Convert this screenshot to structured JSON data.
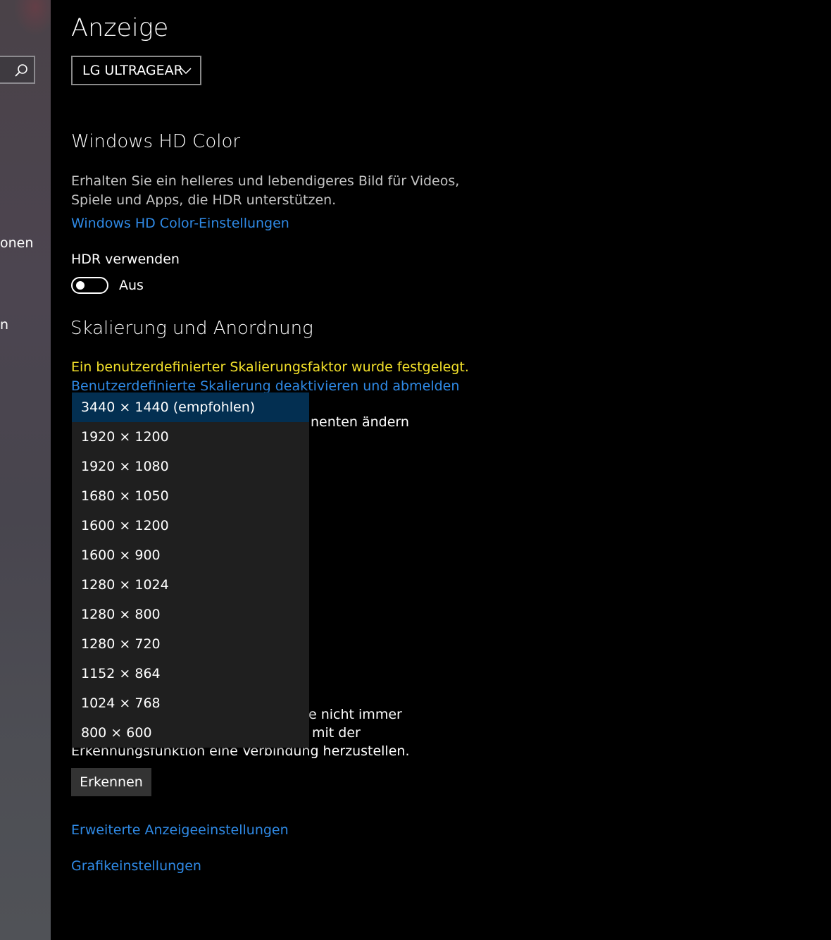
{
  "sidebar": {
    "partial_labels": [
      "onen",
      "n"
    ]
  },
  "page": {
    "title": "Anzeige",
    "display_select": {
      "value": "LG ULTRAGEAR"
    }
  },
  "hdr_section": {
    "title": "Windows HD Color",
    "description_line1": "Erhalten Sie ein helleres und lebendigeres Bild für Videos,",
    "description_line2": "Spiele und Apps, die HDR unterstützen.",
    "link": "Windows HD Color-Einstellungen",
    "toggle_label": "HDR verwenden",
    "toggle_state": "Aus"
  },
  "scaling_section": {
    "title": "Skalierung und Anordnung",
    "warning": "Ein benutzerdefinierter Skalierungsfaktor wurde festgelegt.",
    "link": "Benutzerdefinierte Skalierung deaktivieren und abmelden",
    "partial_text": "nenten ändern"
  },
  "resolution_dropdown": {
    "options": [
      "3440 × 1440 (empfohlen)",
      "1920 × 1200",
      "1920 × 1080",
      "1680 × 1050",
      "1600 × 1200",
      "1600 × 900",
      "1280 × 1024",
      "1280 × 800",
      "1280 × 720",
      "1152 × 864",
      "1024 × 768",
      "800 × 600"
    ],
    "selected_index": 0
  },
  "detect_section": {
    "partial_line1": "e nicht immer",
    "partial_line2": "mit der",
    "partial_line3": "Erkennungsfunktion eine Verbindung herzustellen.",
    "button": "Erkennen"
  },
  "links": {
    "advanced": "Erweiterte Anzeigeeinstellungen",
    "graphics": "Grafikeinstellungen"
  },
  "colors": {
    "link": "#2f8ae6",
    "warning": "#f3e12a",
    "selected": "#032f51",
    "background": "#000000"
  }
}
